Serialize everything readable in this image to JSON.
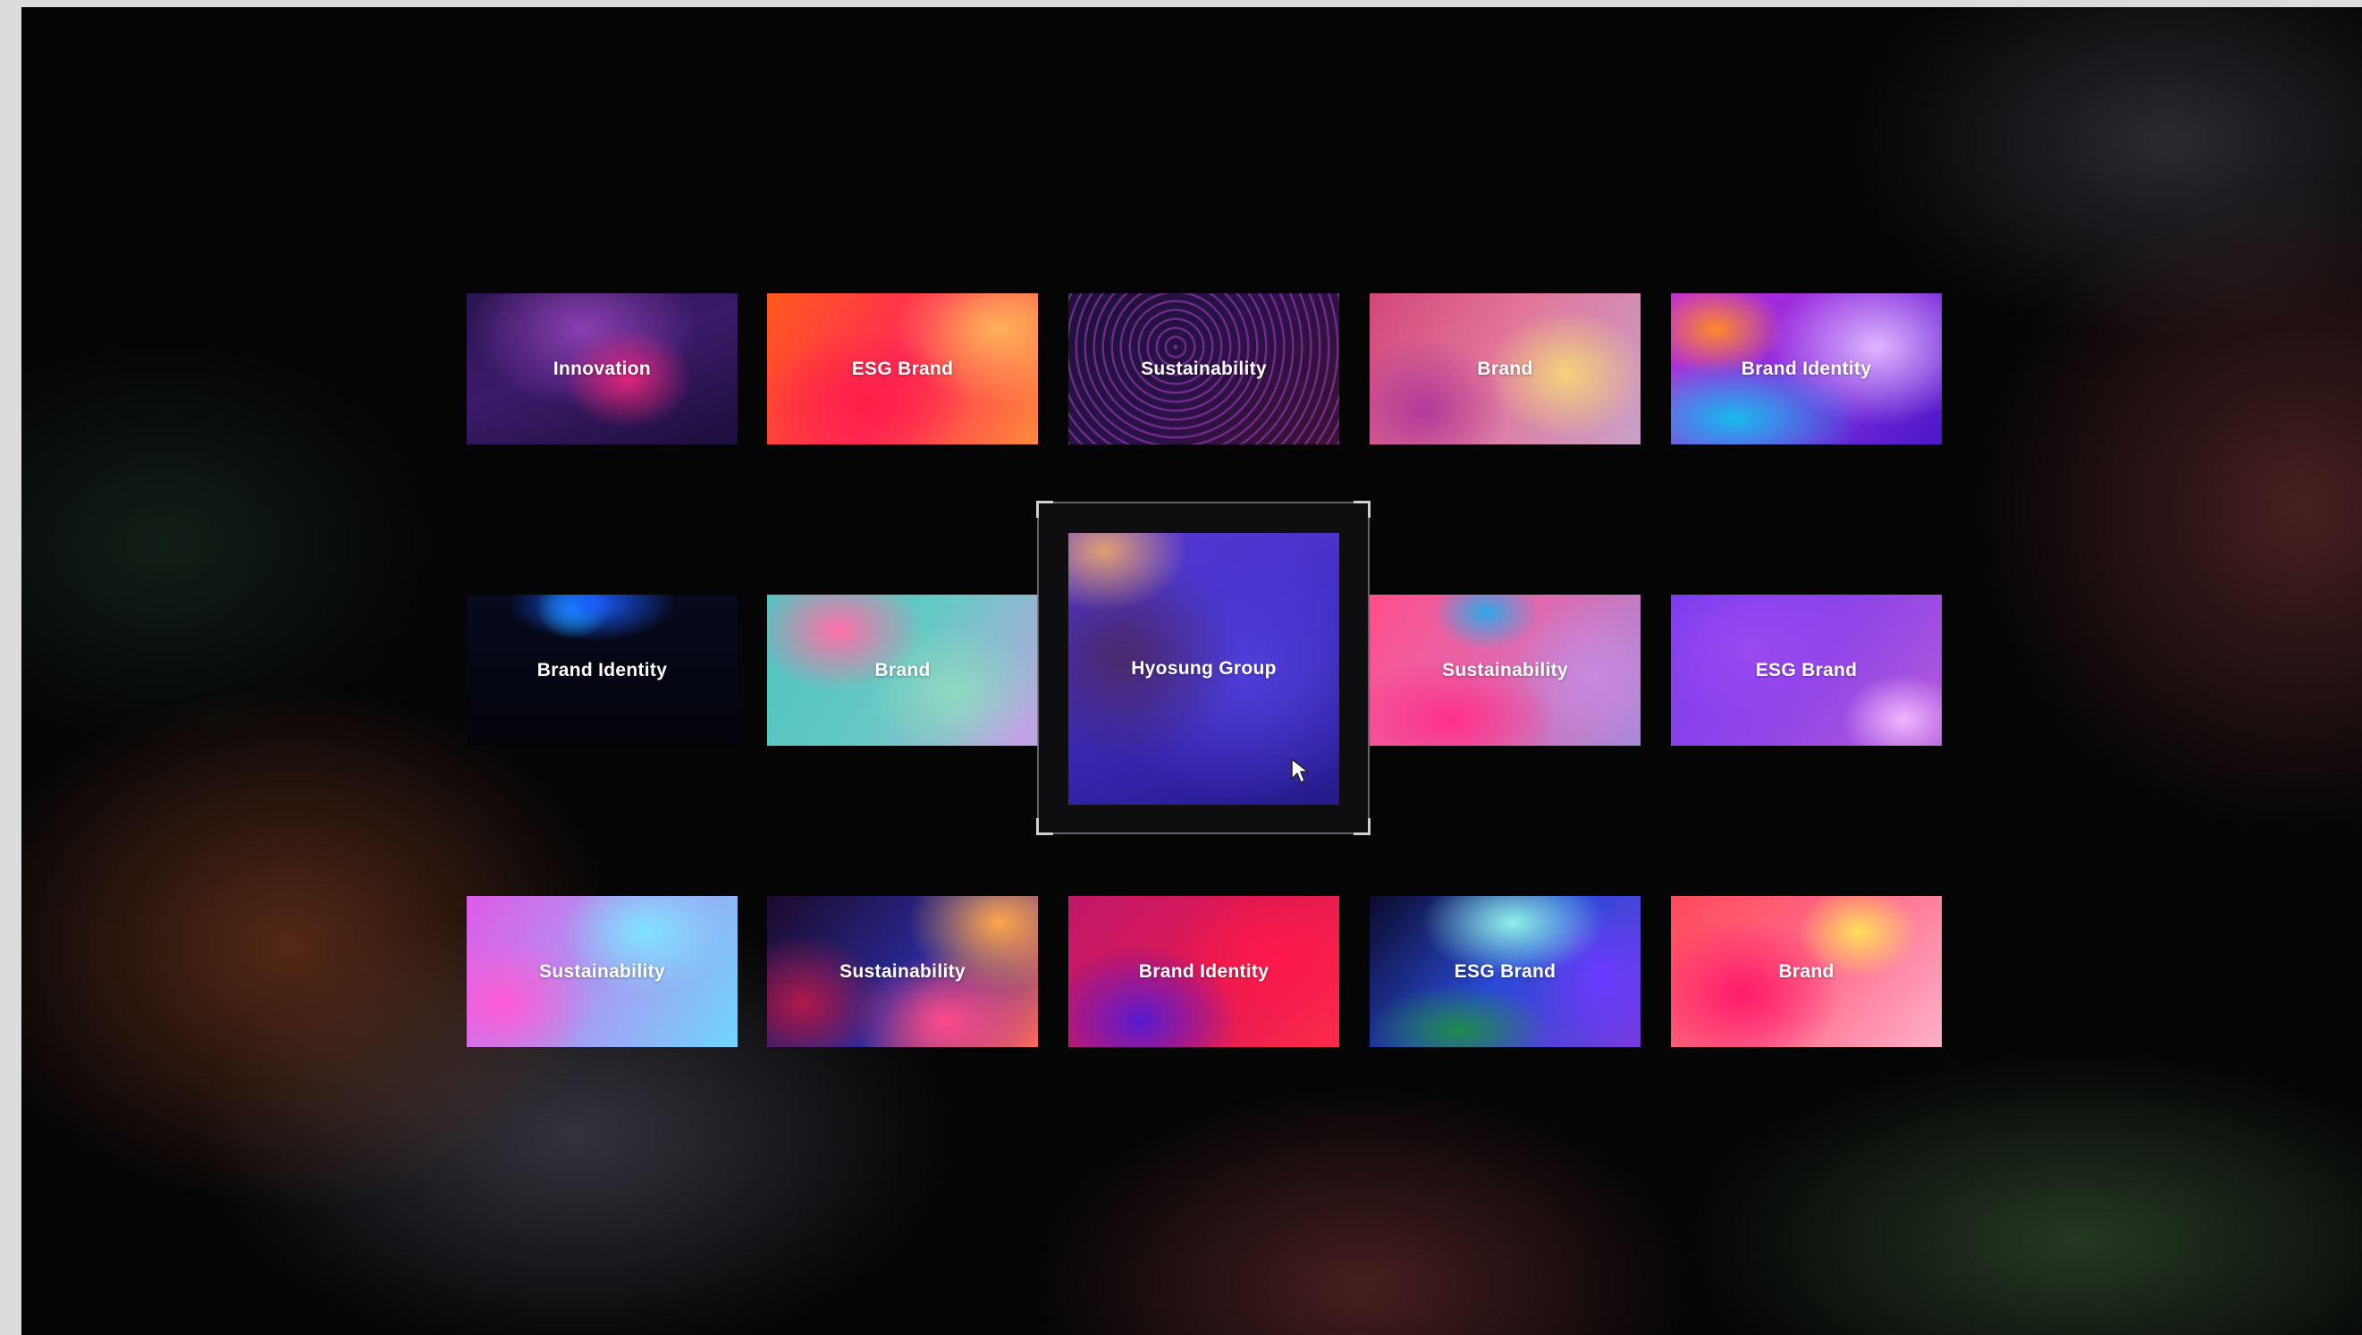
{
  "gallery": {
    "row1": [
      {
        "label": "Innovation"
      },
      {
        "label": "ESG Brand"
      },
      {
        "label": "Sustainability"
      },
      {
        "label": "Brand"
      },
      {
        "label": "Brand Identity"
      }
    ],
    "row2": [
      {
        "label": "Brand Identity"
      },
      {
        "label": "Brand"
      },
      {
        "label": "Hyosung Group"
      },
      {
        "label": "Sustainability"
      },
      {
        "label": "ESG Brand"
      }
    ],
    "row3": [
      {
        "label": "Sustainability"
      },
      {
        "label": "Sustainability"
      },
      {
        "label": "Brand Identity"
      },
      {
        "label": "ESG Brand"
      },
      {
        "label": "Brand"
      }
    ]
  },
  "icons": {
    "cursor": "mouse-pointer-icon"
  },
  "colors": {
    "background": "#050506",
    "selection_corner": "#cfcfd4"
  }
}
